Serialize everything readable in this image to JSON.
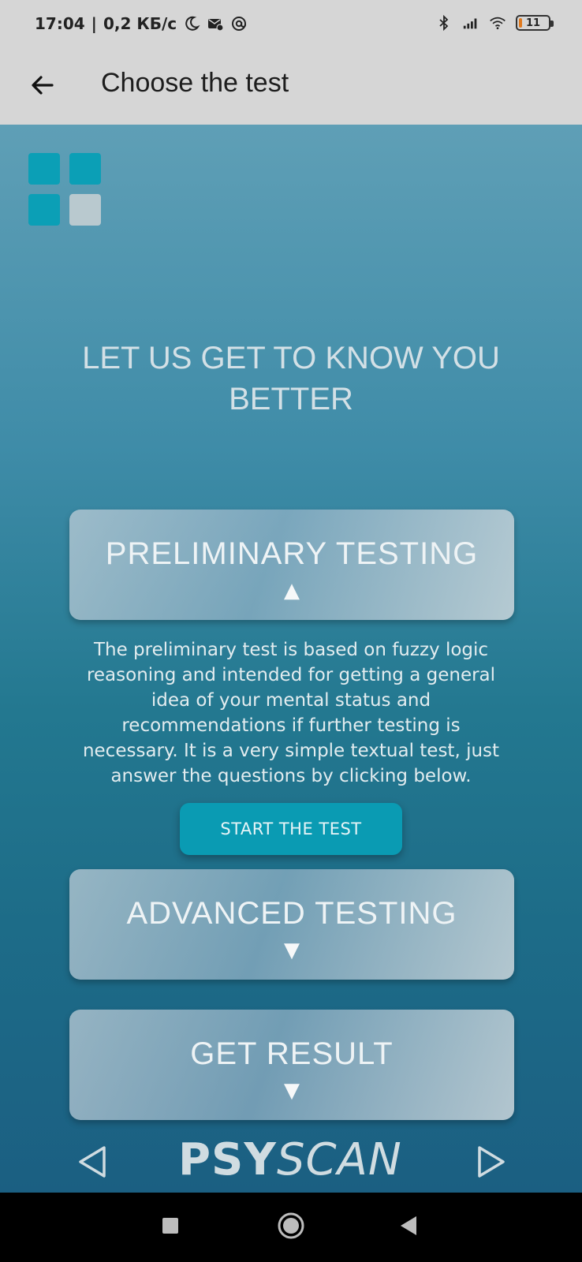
{
  "status_bar": {
    "time": "17:04",
    "separator": "|",
    "speed": "0,2 КБ/с",
    "battery_level": "11",
    "icons": [
      "moon-icon",
      "mail-icon",
      "at-icon",
      "bluetooth-icon",
      "signal-icon",
      "wifi-icon",
      "battery-icon"
    ]
  },
  "app_bar": {
    "title": "Choose the test",
    "back_icon": "arrow-left-icon"
  },
  "main": {
    "headline": "LET US GET TO KNOW YOU BETTER",
    "grid_icon_colors": [
      "#0b9fb6",
      "#0b9fb6",
      "#0b9fb6",
      "#b9c9cf"
    ],
    "sections": [
      {
        "title": "PRELIMINARY TESTING",
        "arrow": "▲",
        "expanded": true
      },
      {
        "title": "ADVANCED TESTING",
        "arrow": "▼",
        "expanded": false
      },
      {
        "title": "GET RESULT",
        "arrow": "▼",
        "expanded": false
      }
    ],
    "description": "The preliminary test is based on fuzzy logic reasoning and intended for getting a general idea of your mental status and recommendations if further testing is necessary. It is a very simple textual test, just answer the questions by clicking below.",
    "start_button": "START THE TEST"
  },
  "footer": {
    "brand_bold": "PSY",
    "brand_italic": "SCAN",
    "prev_icon": "triangle-left-icon",
    "next_icon": "triangle-right-icon"
  },
  "colors": {
    "accent": "#0a9bb3",
    "status_bar_bg": "#d6d6d6",
    "gradient_top": "#5f9fb6",
    "gradient_bottom": "#1b5f82"
  }
}
